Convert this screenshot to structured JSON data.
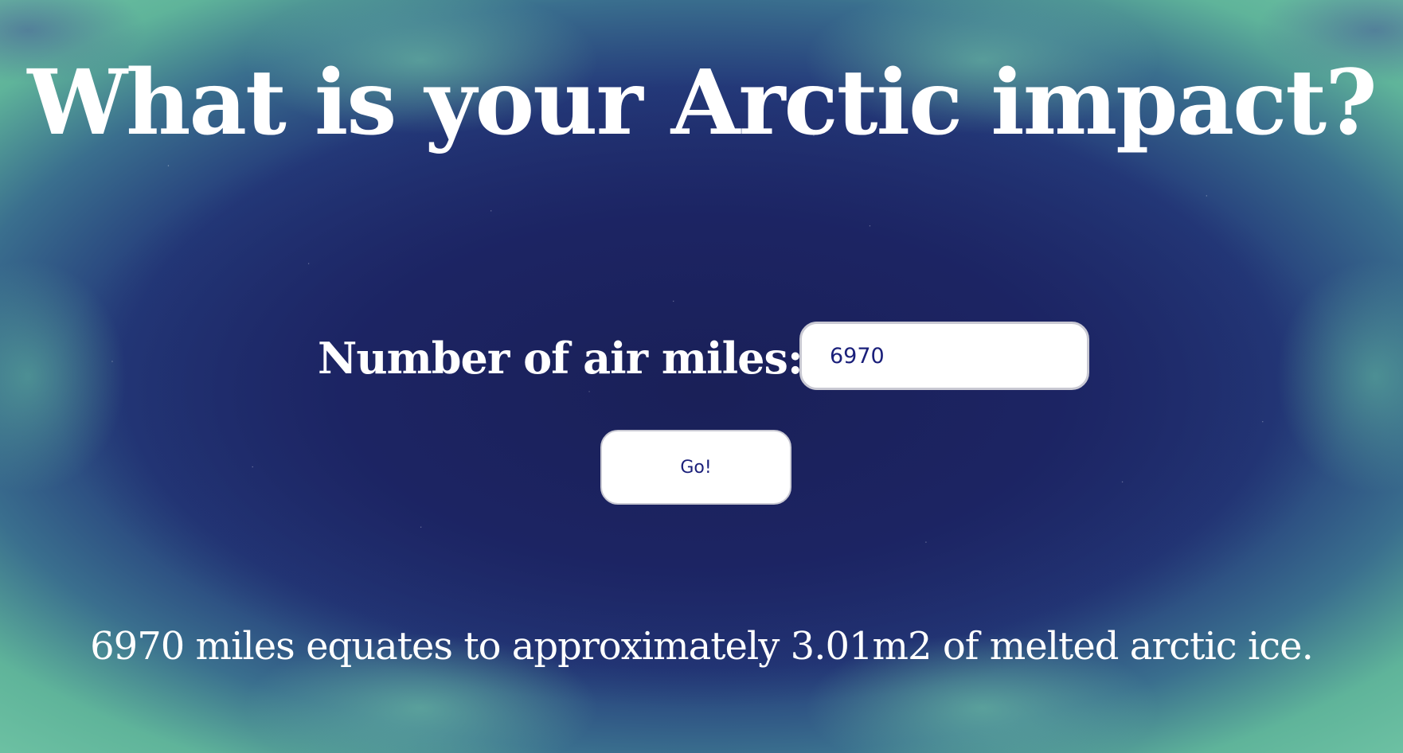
{
  "header": {
    "title": "What is your Arctic impact?"
  },
  "form": {
    "label": "Number of air miles:",
    "input_value": "6970",
    "button_label": "Go!"
  },
  "result": {
    "text": "6970 miles equates to approximately 3.01m2 of melted arctic ice."
  },
  "colors": {
    "text": "#ffffff",
    "input_text": "#1a1f7a",
    "background_center": "#1b2260",
    "aurora_green": "#6fc3a4"
  }
}
